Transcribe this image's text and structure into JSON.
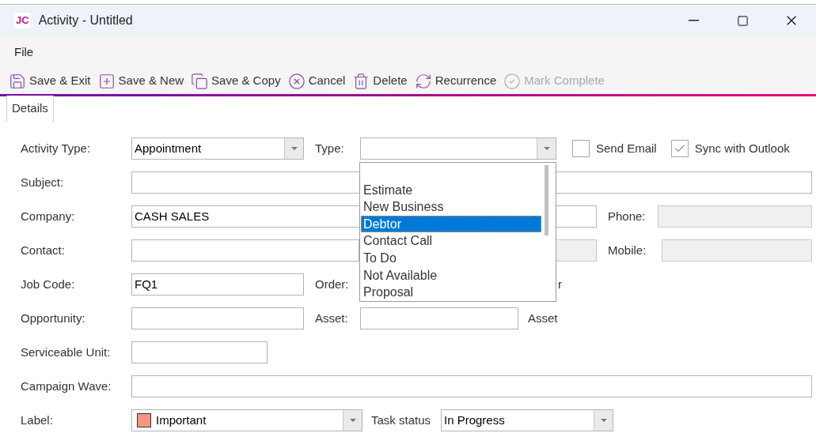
{
  "window": {
    "logo": "JC",
    "title": "Activity - Untitled"
  },
  "menu": [
    {
      "label": "File"
    }
  ],
  "toolbar": [
    {
      "kind": "save-exit",
      "label": "Save & Exit",
      "disabled": false
    },
    {
      "kind": "save-new",
      "label": "Save & New",
      "disabled": false
    },
    {
      "kind": "save-copy",
      "label": "Save & Copy",
      "disabled": false
    },
    {
      "kind": "cancel",
      "label": "Cancel",
      "disabled": false
    },
    {
      "kind": "delete",
      "label": "Delete",
      "disabled": false
    },
    {
      "kind": "recurrence",
      "label": "Recurrence",
      "disabled": false
    },
    {
      "kind": "complete",
      "label": "Mark Complete",
      "disabled": true
    }
  ],
  "tabs": [
    {
      "label": "Details",
      "selected": true
    }
  ],
  "form": {
    "activity_type": {
      "label": "Activity Type:",
      "value": "Appointment"
    },
    "type": {
      "label": "Type:"
    },
    "send_email": {
      "label": "Send Email",
      "checked": false
    },
    "sync_outlook": {
      "label": "Sync with Outlook",
      "checked": true
    },
    "subject": {
      "label": "Subject:"
    },
    "company": {
      "label": "Company:",
      "value": "CASH SALES"
    },
    "phone": {
      "label": "Phone:",
      "disabled": true
    },
    "contact": {
      "label": "Contact:"
    },
    "mobile": {
      "label": "Mobile:",
      "disabled": true
    },
    "job_code": {
      "label": "Job Code:",
      "value": "FQ1"
    },
    "order": {
      "label": "Order:",
      "trailing": "r"
    },
    "opportunity": {
      "label": "Opportunity:"
    },
    "asset": {
      "label": "Asset:",
      "trailing": "Asset"
    },
    "serviceable_unit": {
      "label": "Serviceable Unit:"
    },
    "campaign_wave": {
      "label": "Campaign Wave:"
    },
    "label": {
      "label": "Label:",
      "value": "Important",
      "color": "#f99585"
    },
    "task_status": {
      "label": "Task status",
      "value": "In Progress"
    }
  },
  "type_dropdown": {
    "items": [
      {
        "label": "Estimate",
        "selected": false
      },
      {
        "label": "New Business",
        "selected": false
      },
      {
        "label": "Debtor",
        "selected": true
      },
      {
        "label": "Contact Call",
        "selected": false
      },
      {
        "label": "To Do",
        "selected": false
      },
      {
        "label": "Not Available",
        "selected": false
      },
      {
        "label": "Proposal",
        "selected": false
      }
    ]
  }
}
